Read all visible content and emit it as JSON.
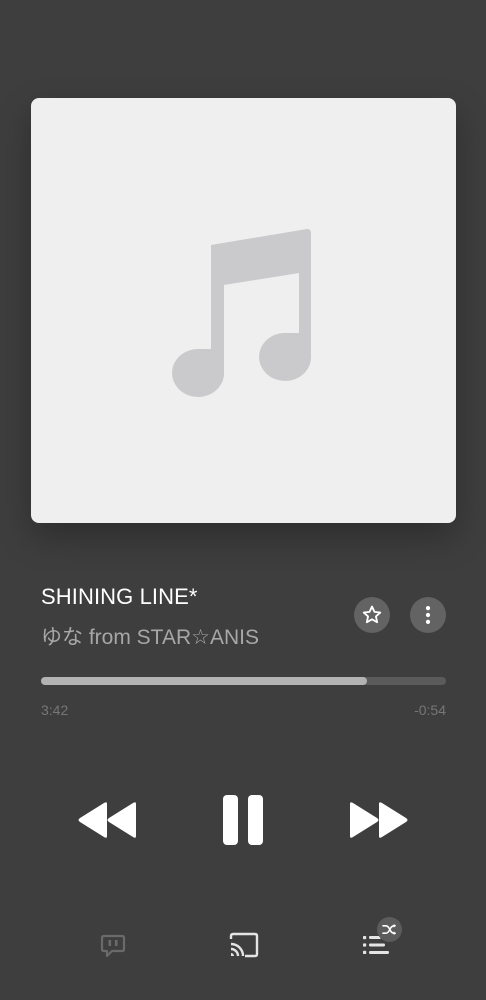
{
  "now_playing": {
    "title": "SHINING LINE*",
    "artist": "ゆな from STAR☆ANIS"
  },
  "progress": {
    "elapsed": "3:42",
    "remaining": "-0:54",
    "fraction": 0.804
  },
  "icons": {
    "artwork_placeholder": "music-note-icon",
    "favorite": "star-outline-icon",
    "more": "vertical-ellipsis-icon",
    "rewind": "rewind-icon",
    "pause": "pause-icon",
    "fast_forward": "fast-forward-icon",
    "lyrics": "lyrics-bubble-icon",
    "cast": "cast-icon",
    "queue": "queue-list-icon",
    "shuffle": "shuffle-icon"
  },
  "colors": {
    "background": "#3e3e3e",
    "artwork_bg": "#efefef",
    "title": "#ffffff",
    "artist": "#a7a7a7",
    "progress_fill": "#b3b3b3",
    "progress_track": "#5b5b5b"
  }
}
